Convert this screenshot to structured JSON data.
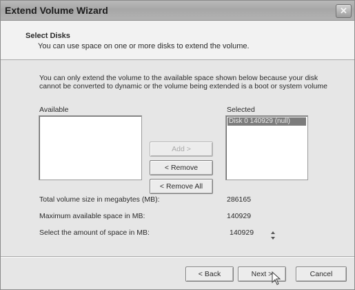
{
  "window": {
    "title": "Extend Volume Wizard",
    "close_glyph": "✕"
  },
  "header": {
    "title": "Select Disks",
    "subtitle": "You can use space on one or more disks to extend the volume."
  },
  "body": {
    "description": "You can only extend the volume to the available space shown below because your disk cannot be converted to dynamic or the volume being extended is a boot or system volume",
    "available_label": "Available",
    "selected_label": "Selected",
    "add_label": "Add >",
    "remove_label": "< Remove",
    "remove_all_label": "< Remove All",
    "selected_items": [
      "Disk 0    140929 (null)"
    ]
  },
  "summary": {
    "total_label": "Total volume size in megabytes (MB):",
    "total_value": "286165",
    "max_label": "Maximum available space in MB:",
    "max_value": "140929",
    "select_label": "Select the amount of space in MB:",
    "select_value": "140929"
  },
  "footer": {
    "back_label": "< Back",
    "next_label": "Next >",
    "cancel_label": "Cancel"
  },
  "icons": {
    "cursor": "mouse-pointer-icon",
    "spinner": "spinner-arrows-icon"
  }
}
